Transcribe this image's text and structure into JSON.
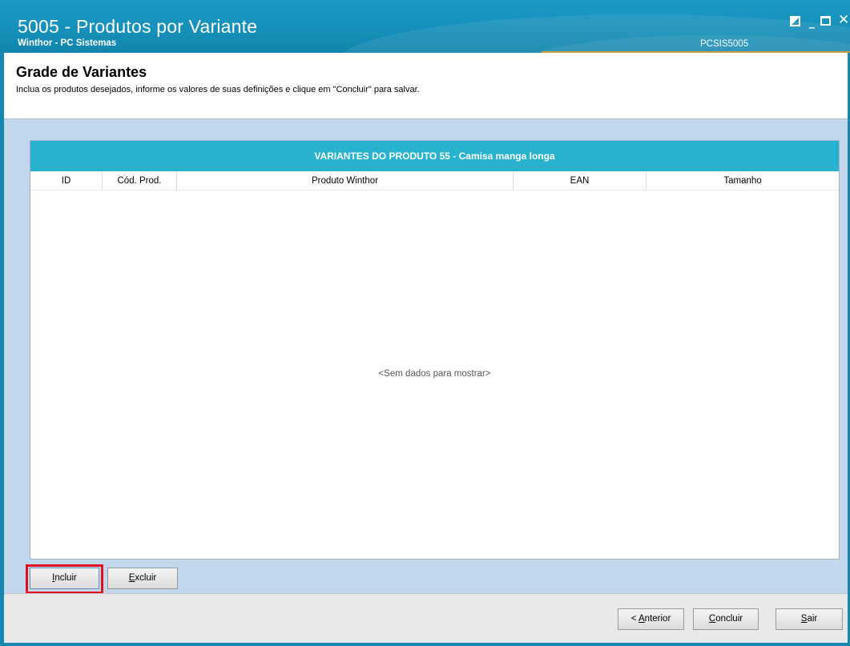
{
  "window": {
    "title": "5005 - Produtos por Variante",
    "subtitle": "Winthor - PC Sistemas",
    "code": "PCSIS5005"
  },
  "header": {
    "title": "Grade de Variantes",
    "description": "Inclua os produtos desejados, informe os valores de suas definições e clique em \"Concluir\" para salvar."
  },
  "grid": {
    "banner": "VARIANTES DO PRODUTO 55 - Camisa manga longa",
    "columns": [
      "ID",
      "Cód. Prod.",
      "Produto Winthor",
      "EAN",
      "Tamanho"
    ],
    "empty_message": "<Sem dados para mostrar>"
  },
  "actions": {
    "incluir_prefix": "",
    "incluir_accel": "I",
    "incluir_rest": "ncluir",
    "excluir_accel": "E",
    "excluir_rest": "xcluir"
  },
  "footer": {
    "anterior_prefix": "< ",
    "anterior_accel": "A",
    "anterior_rest": "nterior",
    "concluir_accel": "C",
    "concluir_rest": "oncluir",
    "sair_accel": "S",
    "sair_rest": "air"
  },
  "colors": {
    "titlebar": "#1690bb",
    "banner": "#27b2cf",
    "body_bg": "#c2d7ec",
    "highlight": "#e0101e"
  }
}
